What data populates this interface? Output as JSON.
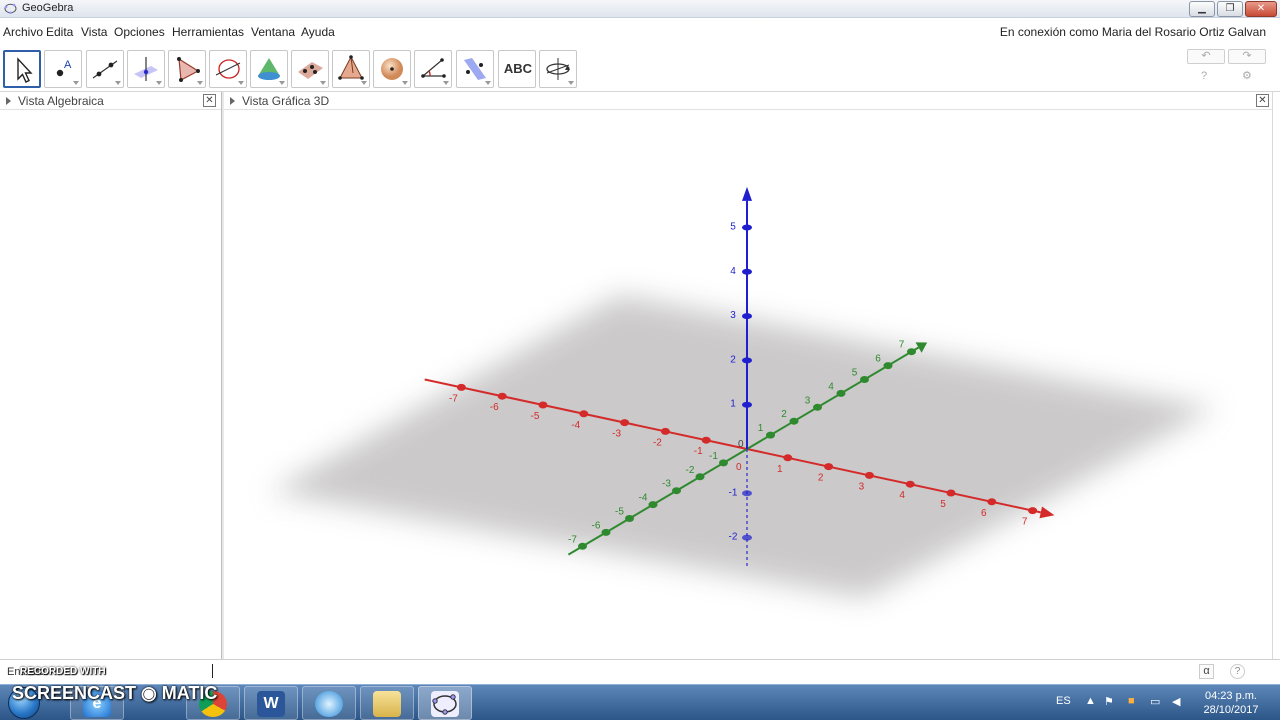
{
  "window": {
    "title": "GeoGebra",
    "buttons": [
      "▁",
      "❐",
      "✕"
    ]
  },
  "menu": {
    "items": [
      "Archivo",
      "Edita",
      "Vista",
      "Opciones",
      "Herramientas",
      "Ventana",
      "Ayuda"
    ],
    "login": "En conexión como Maria del Rosario Ortiz Galvan"
  },
  "toolbar": {
    "tools": [
      {
        "name": "move-tool-icon",
        "selected": true
      },
      {
        "name": "point-tool-icon",
        "label": "A"
      },
      {
        "name": "line-tool-icon"
      },
      {
        "name": "perpendicular-tool-icon"
      },
      {
        "name": "polygon-tool-icon"
      },
      {
        "name": "circle-axis-tool-icon"
      },
      {
        "name": "cone-tool-icon"
      },
      {
        "name": "plane-points-tool-icon"
      },
      {
        "name": "pyramid-tool-icon"
      },
      {
        "name": "sphere-tool-icon"
      },
      {
        "name": "angle-tool-icon"
      },
      {
        "name": "reflect-tool-icon"
      },
      {
        "name": "text-tool-icon",
        "label": "ABC"
      },
      {
        "name": "rotate-view-tool-icon"
      }
    ],
    "undo": "↶",
    "redo": "↷",
    "help": "?",
    "settings": "⚙"
  },
  "panels": {
    "algebra": {
      "label": "Vista Algebraica",
      "close": "✕"
    },
    "graphics3d": {
      "label": "Vista Gráfica 3D",
      "close": "✕"
    }
  },
  "axes3d": {
    "colors": {
      "x": "#d42a2a",
      "y": "#2f8a2f",
      "z": "#1f1fcf",
      "plane": "#c9c7c8"
    },
    "x_ticks": [
      "-7",
      "-6",
      "-5",
      "-4",
      "-3",
      "-2",
      "-1",
      "0",
      "1",
      "2",
      "3",
      "4",
      "5",
      "6",
      "7"
    ],
    "y_ticks": [
      "-7",
      "-6",
      "-5",
      "-4",
      "-3",
      "-2",
      "-1",
      "1",
      "2",
      "3",
      "4",
      "5",
      "6",
      "7"
    ],
    "z_ticks": [
      "-2",
      "-1",
      "1",
      "2",
      "3",
      "4",
      "5"
    ],
    "origin": "0"
  },
  "inputbar": {
    "label": "Entrada:",
    "alpha": "α",
    "help": "?"
  },
  "watermark": {
    "recorded": "RECORDED WITH",
    "brand": "SCREENCAST ◉ MATIC"
  },
  "taskbar": {
    "apps": [
      "ie-icon",
      "chrome-icon",
      "word-icon",
      "media-icon",
      "folder-icon",
      "geogebra-icon"
    ],
    "word_letter": "W",
    "lang": "ES",
    "time": "04:23 p.m.",
    "date": "28/10/2017"
  }
}
